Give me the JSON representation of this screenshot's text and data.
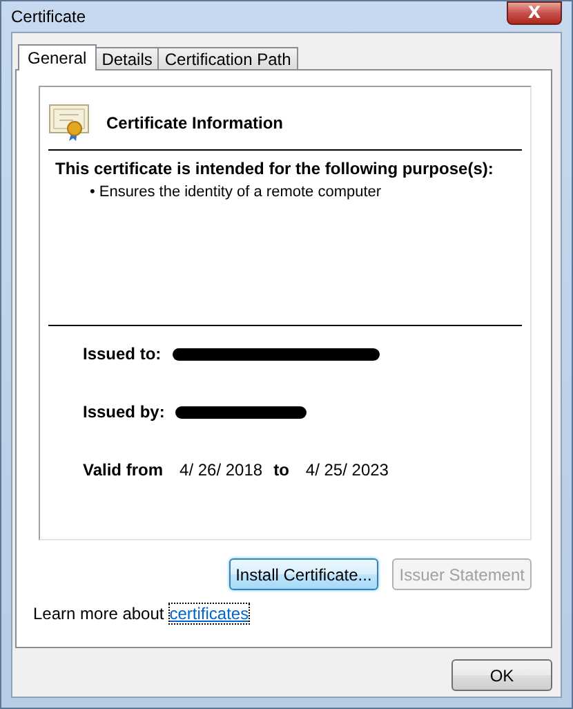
{
  "window": {
    "title": "Certificate",
    "close_label": "X"
  },
  "tabs": [
    {
      "label": "General",
      "selected": true
    },
    {
      "label": "Details",
      "selected": false
    },
    {
      "label": "Certification Path",
      "selected": false
    }
  ],
  "info": {
    "heading": "Certificate Information",
    "purpose_title": "This certificate is intended for the following purpose(s):",
    "purposes": [
      {
        "bullet": "•",
        "text": "Ensures the identity of a remote computer"
      }
    ],
    "issued_to": {
      "label": "Issued to:",
      "redacted": true
    },
    "issued_by": {
      "label": "Issued by:",
      "redacted": true
    },
    "valid_from_label": "Valid from",
    "valid_from": "4/ 26/ 2018",
    "valid_to_label": "to",
    "valid_to": "4/ 25/ 2023"
  },
  "buttons": [
    {
      "label": "Install Certificate...",
      "default": true,
      "disabled": false
    },
    {
      "label": "Issuer Statement",
      "default": false,
      "disabled": true
    }
  ],
  "learn_more": {
    "text": "Learn more about",
    "link": "certificates"
  },
  "footer_buttons": [
    {
      "label": "OK",
      "default": false,
      "disabled": false
    }
  ]
}
